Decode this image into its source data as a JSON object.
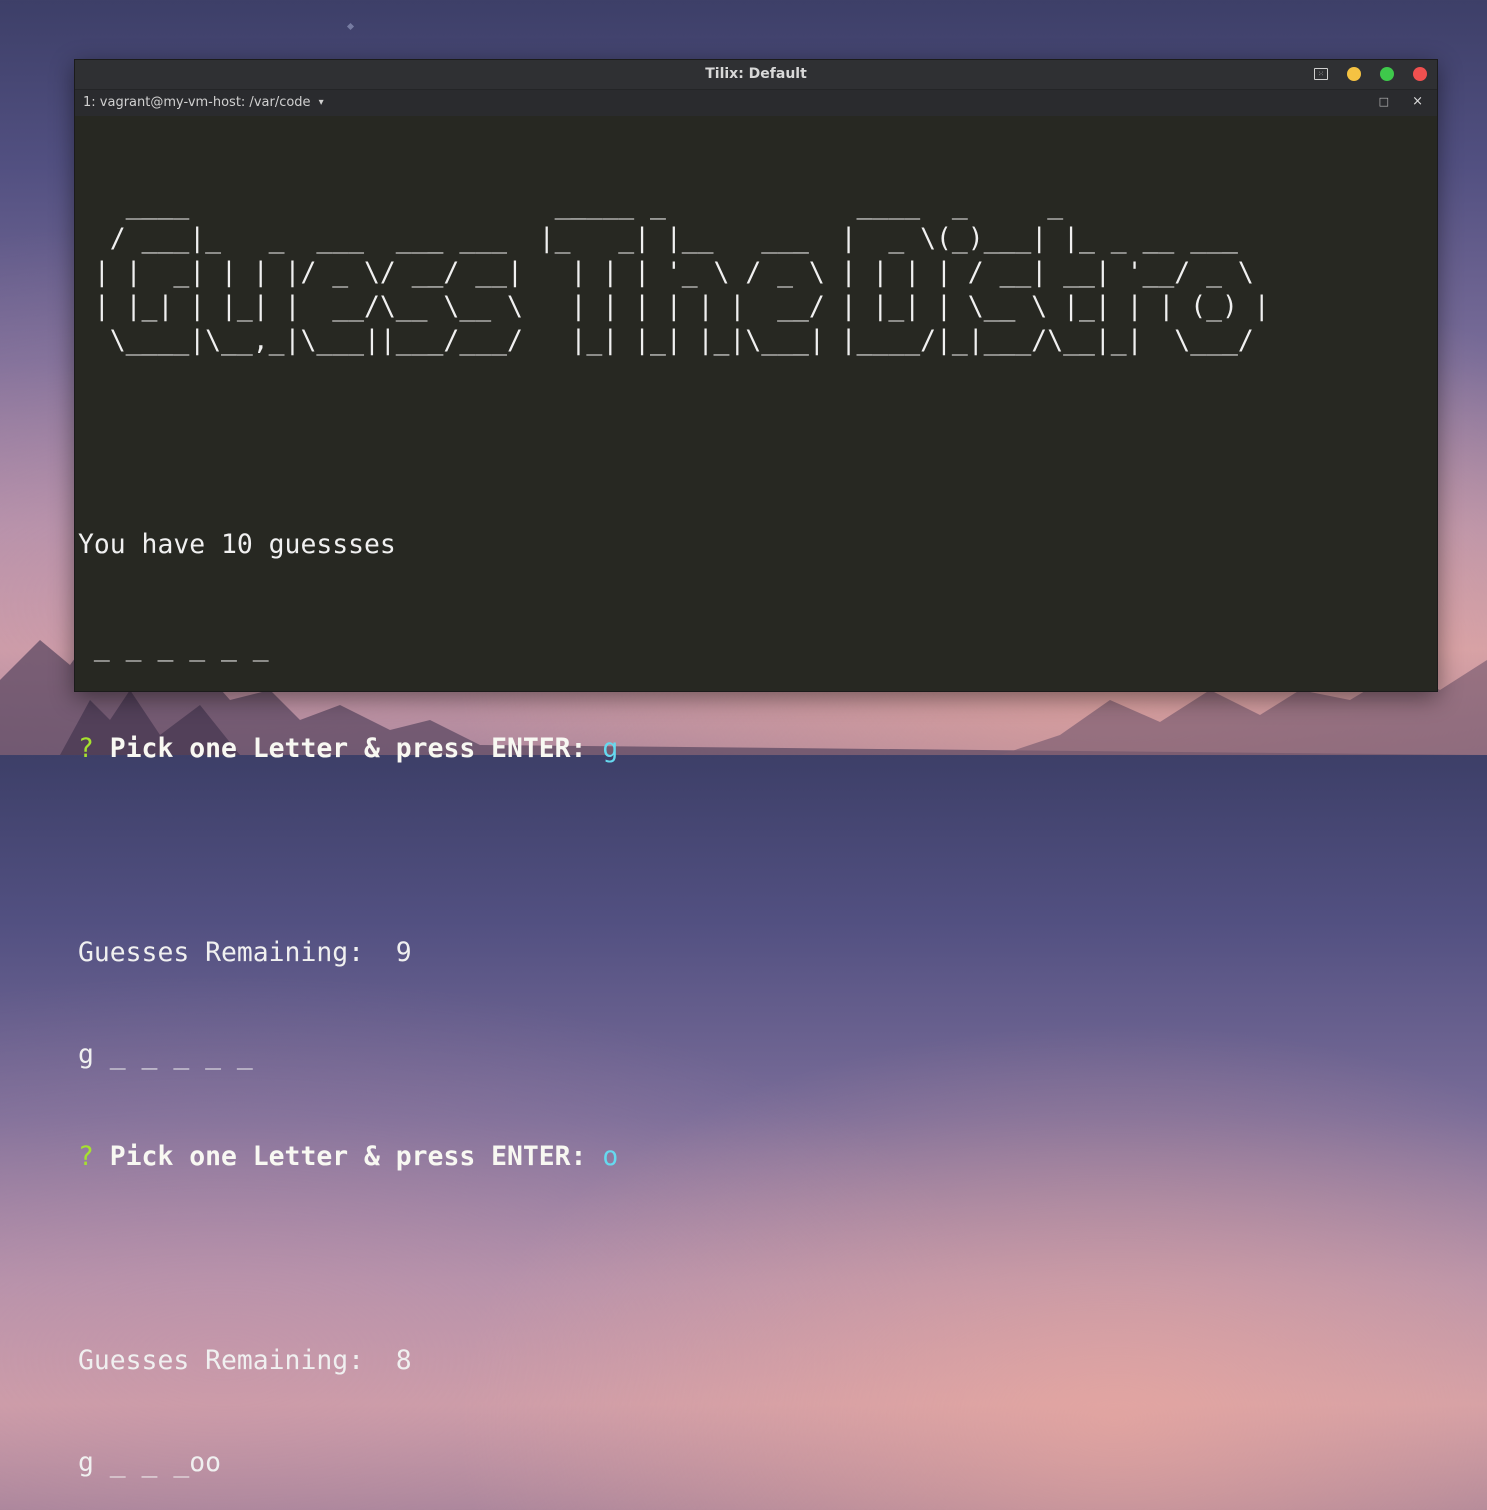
{
  "window": {
    "title": "Tilix: Default",
    "tab_label": "1: vagrant@my-vm-host: /var/code",
    "tab_caret": "▾",
    "tab_maximize": "□",
    "tab_close": "×",
    "controls": {
      "minimize_color": "#f5c242",
      "maximize_color": "#3ec94b",
      "close_color": "#f0504f"
    }
  },
  "terminal": {
    "banner": "   ____                       _____ _            ____  _     _\n  / ___|_   _  ___  ___ ___  |_   _| |__   ___  |  _ \\(_)___| |_ _ __ ___\n | |  _| | | |/ _ \\/ __/ __|   | | | '_ \\ / _ \\ | | | | / __| __| '__/ _ \\\n | |_| | |_| |  __/\\__ \\__ \\   | | | | | |  __/ | |_| | \\__ \\ |_| | | (_) |\n  \\____|\\__,_|\\___||___/___/   |_| |_| |_|\\___| |____/|_|___/\\__|_|  \\___/",
    "intro": "You have 10 guessses",
    "prompt_mark": "?",
    "prompt_text": "Pick one Letter & press ENTER: ",
    "rounds": [
      {
        "word": " _ _ _ _ _ _",
        "answer": "g",
        "remaining": "Guesses Remaining:  9"
      },
      {
        "word": "g _ _ _ _ _",
        "answer": "o",
        "remaining": "Guesses Remaining:  8"
      }
    ],
    "current_word": "g _ _ _oo",
    "colors": {
      "background": "#272822",
      "prompt_mark": "#a6e22e",
      "answer": "#66d9ef"
    }
  }
}
